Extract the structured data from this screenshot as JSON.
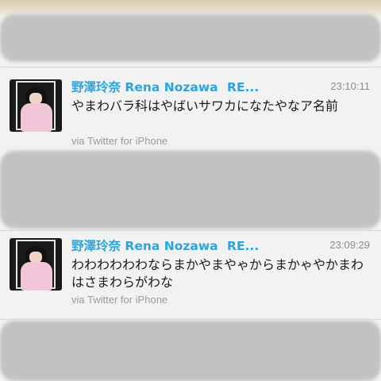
{
  "tweets": [
    {
      "name": "野澤玲奈 Rena Nozawa",
      "truncated": "RE...",
      "time": "23:10:11",
      "text": "やまわバラ科はやばいサワカになたやなア名前",
      "via": "via Twitter for iPhone"
    },
    {
      "name": "野澤玲奈 Rena Nozawa",
      "truncated": "RE...",
      "time": "23:09:29",
      "text": "わわわわわわならまかやまやゃからまかゃやかまわはさまわらがわな",
      "via": "via Twitter for iPhone"
    }
  ],
  "colors": {
    "name": "#2aa5e0",
    "time": "#8c8c8c",
    "via": "#9a9a9a"
  }
}
